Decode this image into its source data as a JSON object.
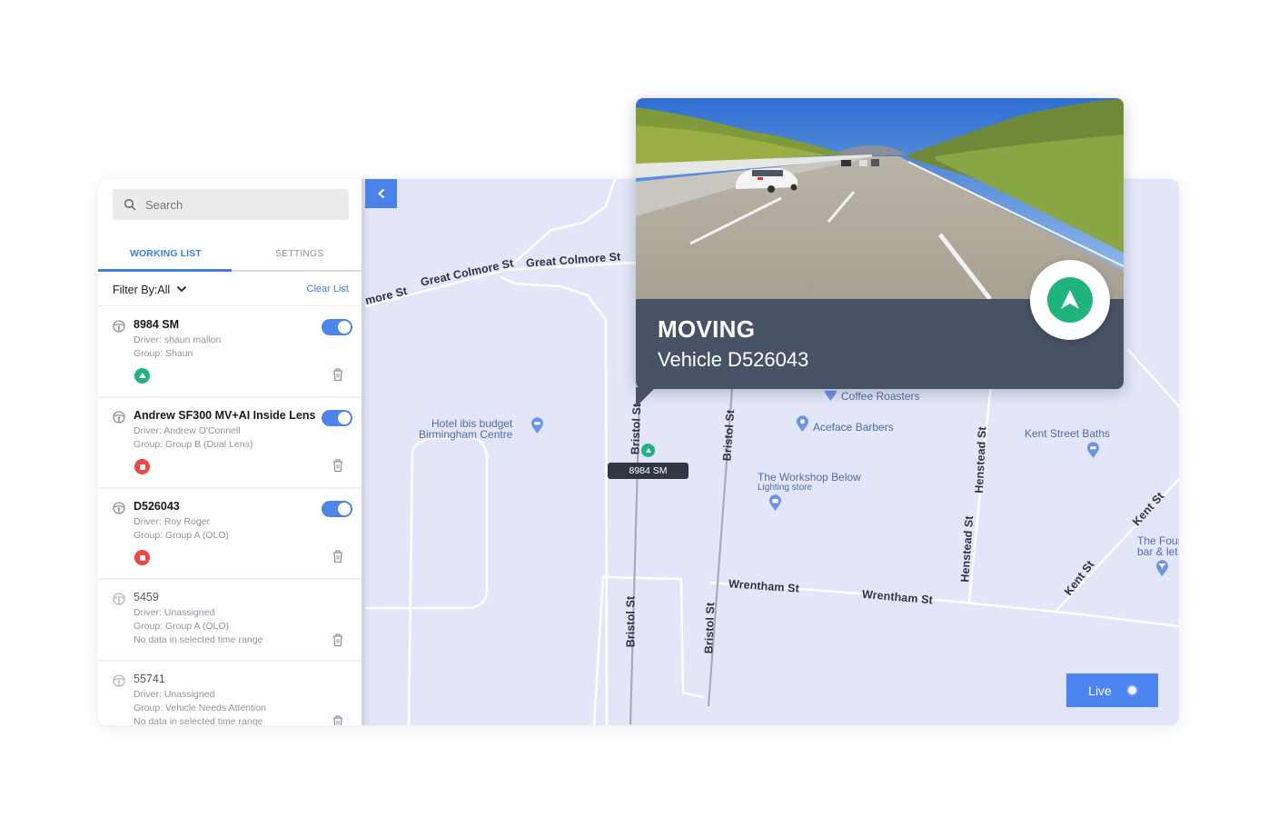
{
  "search": {
    "placeholder": "Search"
  },
  "tabs": [
    {
      "label": "WORKING LIST",
      "active": true
    },
    {
      "label": "SETTINGS",
      "active": false
    }
  ],
  "filter": {
    "label": "Filter By:All",
    "clear_label": "Clear List"
  },
  "vehicles": [
    {
      "name": "8984 SM",
      "driver": "Driver: shaun mallon",
      "group": "Group: Shaun",
      "note": "",
      "tracking": true,
      "status": "moving"
    },
    {
      "name": "Andrew SF300 MV+AI Inside Lens",
      "driver": "Driver: Andrew O'Connell",
      "group": "Group: Group B (Dual Lens)",
      "note": "",
      "tracking": true,
      "status": "stopped"
    },
    {
      "name": "D526043",
      "driver": "Driver: Roy Roger",
      "group": "Group: Group A (OLO)",
      "note": "",
      "tracking": true,
      "status": "stopped"
    },
    {
      "name": "5459",
      "driver": "Driver: Unassigned",
      "group": "Group: Group A (OLO)",
      "note": "No data in selected time range",
      "tracking": false,
      "status": "none"
    },
    {
      "name": "55741",
      "driver": "Driver: Unassigned",
      "group": "Group: Vehicle Needs Attention",
      "note": "No data in selected time range",
      "tracking": false,
      "status": "none"
    }
  ],
  "map": {
    "streets": {
      "great_colmore_1": "Great Colmore St",
      "great_colmore_2": "Great Colmore St",
      "great_colmore_partial": "lmore St",
      "bristol_1": "Bristol St",
      "bristol_2": "Bristol St",
      "bristol_3": "Bristol St",
      "bristol_4": "Bristol St",
      "wrentham_1": "Wrentham St",
      "wrentham_2": "Wrentham St",
      "henstead_1": "Henstead St",
      "henstead_2": "Henstead St",
      "kent_1": "Kent St",
      "kent_2": "Kent St"
    },
    "pois": {
      "hotel_line1": "Hotel ibis budget",
      "hotel_line2": "Birmingham Centre",
      "coffee": "Coffee Roasters",
      "barbers": "Aceface Barbers",
      "workshop": "The Workshop Below",
      "workshop_sub": "Lighting store",
      "baths": "Kent Street Baths",
      "bar_line1": "The Four",
      "bar_line2": "bar & let"
    },
    "vehicle_marker_label": "8984 SM",
    "live_label": "Live"
  },
  "popup": {
    "status": "MOVING",
    "vehicle": "Vehicle D526043",
    "status_color": "#1fb47d"
  },
  "colors": {
    "accent": "#4c84ea",
    "moving": "#1fb47d",
    "stopped": "#ef4545",
    "map_bg": "#e3e6f8",
    "popup_bg": "#475266"
  }
}
